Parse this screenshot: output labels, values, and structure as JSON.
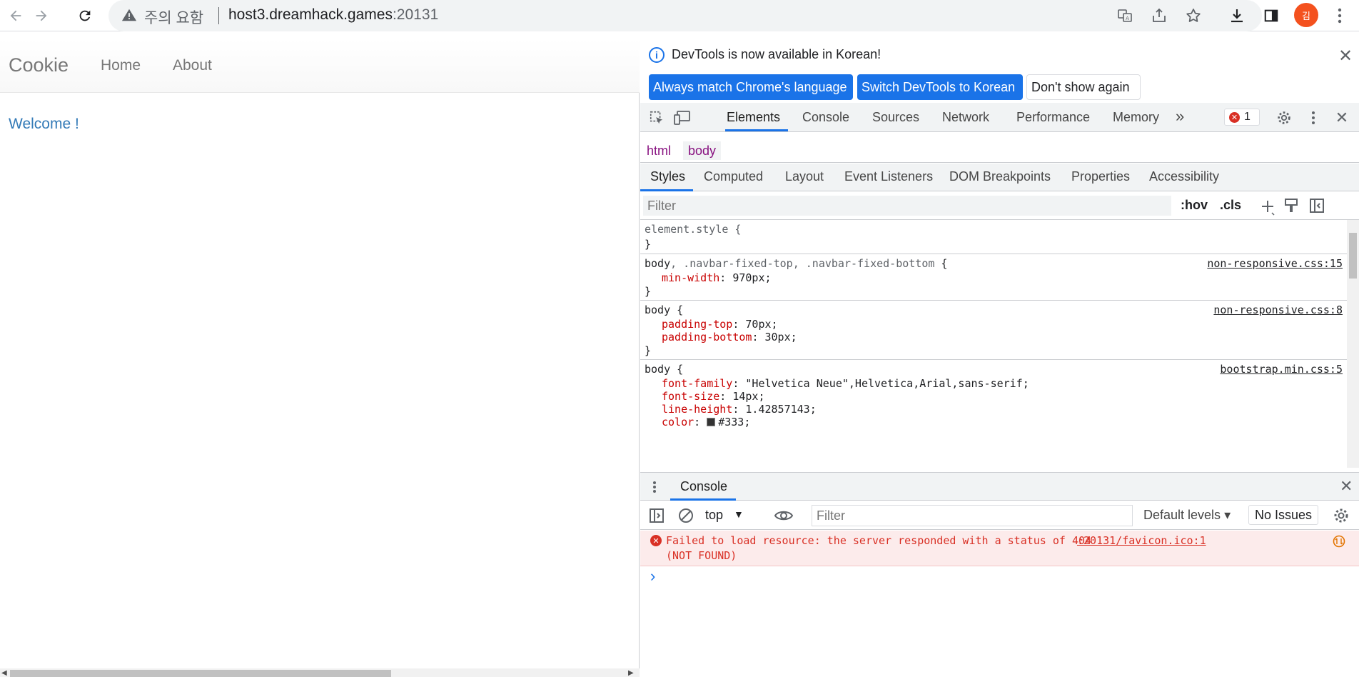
{
  "browser": {
    "security_text": "주의 요함",
    "url_host": "host3.dreamhack.games",
    "url_port": ":20131",
    "avatar_initial": "김"
  },
  "page": {
    "brand": "Cookie",
    "nav": [
      "Home",
      "About"
    ],
    "welcome": "Welcome !"
  },
  "devtools": {
    "infobar": {
      "message": "DevTools is now available in Korean!",
      "btn_match": "Always match Chrome's language",
      "btn_switch": "Switch DevTools to Korean",
      "btn_dont_show": "Don't show again"
    },
    "main_tabs": [
      "Elements",
      "Console",
      "Sources",
      "Network",
      "Performance",
      "Memory"
    ],
    "more_tabs": "»",
    "error_count": "1",
    "breadcrumbs": [
      "html",
      "body"
    ],
    "sub_tabs": [
      "Styles",
      "Computed",
      "Layout",
      "Event Listeners",
      "DOM Breakpoints",
      "Properties",
      "Accessibility"
    ],
    "styles_filter_placeholder": "Filter",
    "hov": ":hov",
    "cls": ".cls",
    "rules": [
      {
        "selector_main": "element.style",
        "selector_dim": "",
        "source": "",
        "props": []
      },
      {
        "selector_main": "body",
        "selector_dim": ", .navbar-fixed-top, .navbar-fixed-bottom",
        "source": "non-responsive.css:15",
        "props": [
          {
            "name": "min-width",
            "value": "970px;"
          }
        ]
      },
      {
        "selector_main": "body",
        "selector_dim": "",
        "source": "non-responsive.css:8",
        "props": [
          {
            "name": "padding-top",
            "value": "70px;"
          },
          {
            "name": "padding-bottom",
            "value": "30px;"
          }
        ]
      },
      {
        "selector_main": "body",
        "selector_dim": "",
        "source": "bootstrap.min.css:5",
        "props": [
          {
            "name": "font-family",
            "value": "\"Helvetica Neue\",Helvetica,Arial,sans-serif;"
          },
          {
            "name": "font-size",
            "value": "14px;"
          },
          {
            "name": "line-height",
            "value": "1.42857143;"
          },
          {
            "name": "color",
            "value": "#333;"
          }
        ]
      }
    ],
    "drawer": {
      "tab": "Console",
      "context": "top",
      "filter_placeholder": "Filter",
      "levels": "Default levels",
      "issues": "No Issues",
      "error_line1": "Failed to load resource: the server responded with a status of 404",
      "error_line2": "(NOT FOUND)",
      "error_source": ":20131/favicon.ico:1",
      "prompt": "›"
    }
  },
  "colors": {
    "link_blue": "#337ab7",
    "devtools_accent": "#1a73e8",
    "error_red": "#d93025",
    "css_prop": "#c80000"
  }
}
